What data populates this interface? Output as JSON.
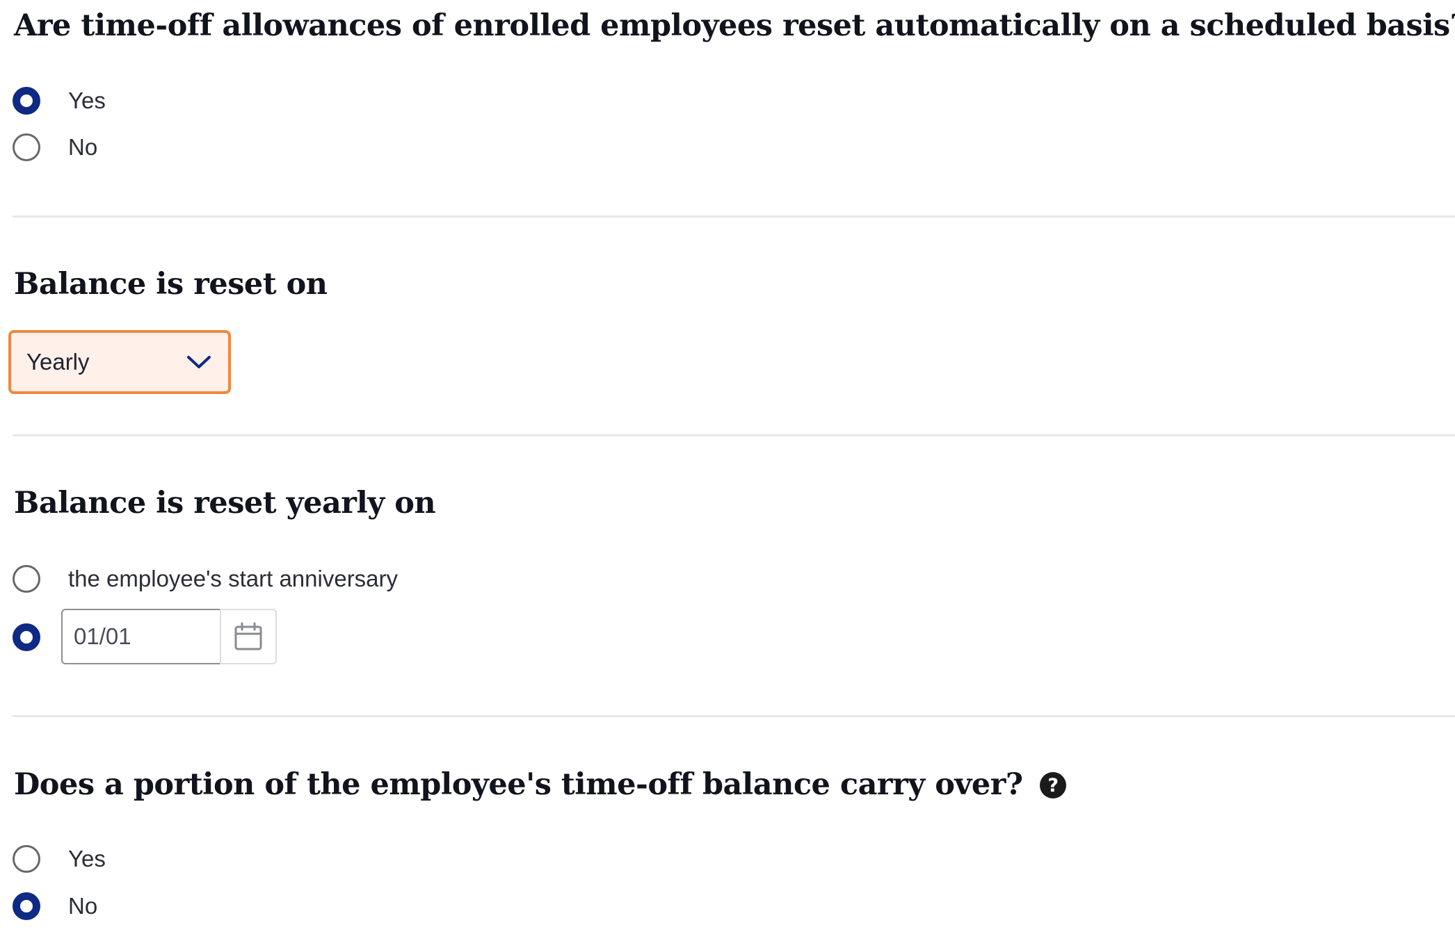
{
  "q1": {
    "title": "Are time-off allowances of enrolled employees reset automatically on a scheduled basis?",
    "options": [
      "Yes",
      "No"
    ],
    "selected": "Yes"
  },
  "q2": {
    "title": "Balance is reset on",
    "select_value": "Yearly"
  },
  "q3": {
    "title": "Balance is reset yearly on",
    "option_anniversary": "the employee's start anniversary",
    "date_value": "01/01",
    "selected": "date"
  },
  "q4": {
    "title": "Does a portion of the employee's time-off balance carry over?",
    "options": [
      "Yes",
      "No"
    ],
    "selected": "No"
  },
  "colors": {
    "radio_selected": "#0f2a85",
    "select_border": "#f0883e",
    "select_background": "#fff1ea",
    "divider": "#e6e7ea"
  },
  "icons": {
    "help": "question-circle-icon",
    "dropdown": "chevron-down-icon",
    "date": "calendar-icon"
  }
}
